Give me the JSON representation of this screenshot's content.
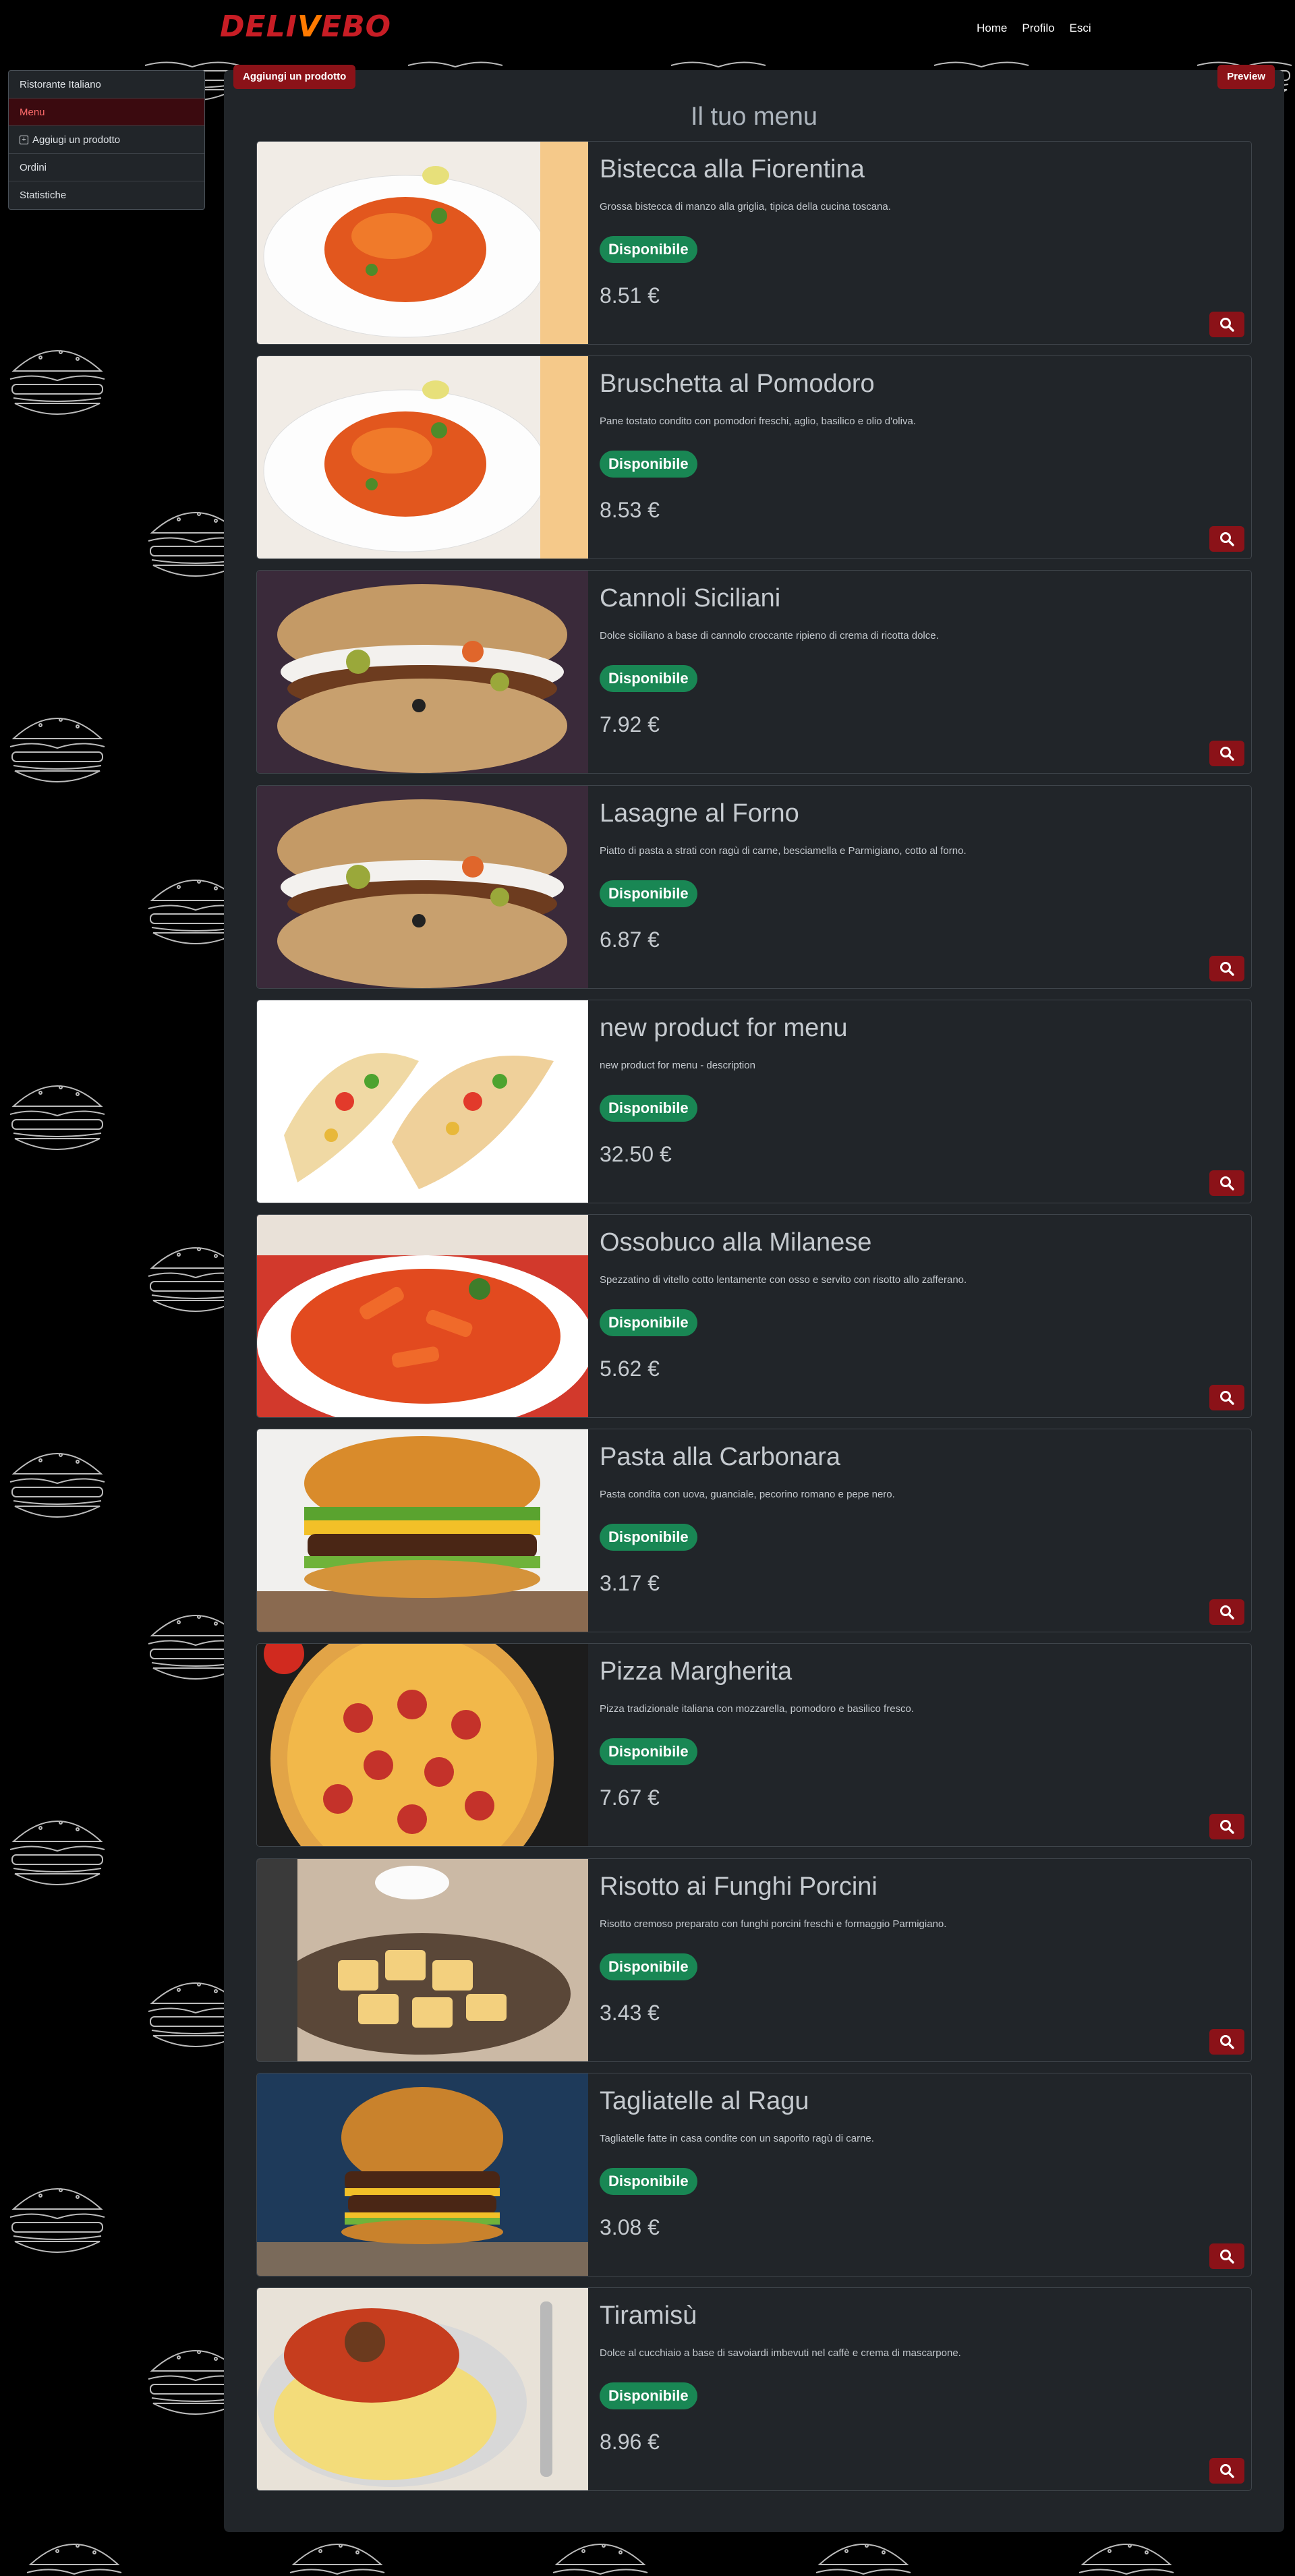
{
  "brand": {
    "logo_text_a": "DELI",
    "logo_text_b": "V",
    "logo_text_c": "EBO"
  },
  "nav": {
    "home": "Home",
    "profile": "Profilo",
    "logout": "Esci"
  },
  "sidebar": {
    "items": [
      {
        "label": "Ristorante Italiano"
      },
      {
        "label": "Menu"
      },
      {
        "label": "Aggiugi un prodotto"
      },
      {
        "label": "Ordini"
      },
      {
        "label": "Statistiche"
      }
    ]
  },
  "toolbar": {
    "add_product": "Aggiungi un prodotto",
    "preview": "Preview"
  },
  "page": {
    "title": "Il tuo menu"
  },
  "products": [
    {
      "name": "Bistecca alla Fiorentina",
      "description": "Grossa bistecca di manzo alla griglia, tipica della cucina toscana.",
      "status": "Disponibile",
      "price": "8.51 €",
      "image": "pasta"
    },
    {
      "name": "Bruschetta al Pomodoro",
      "description": "Pane tostato condito con pomodori freschi, aglio, basilico e olio d'oliva.",
      "status": "Disponibile",
      "price": "8.53 €",
      "image": "pasta"
    },
    {
      "name": "Cannoli Siciliani",
      "description": "Dolce siciliano a base di cannolo croccante ripieno di crema di ricotta dolce.",
      "status": "Disponibile",
      "price": "7.92 €",
      "image": "sandwich"
    },
    {
      "name": "Lasagne al Forno",
      "description": "Piatto di pasta a strati con ragù di carne, besciamella e Parmigiano, cotto al forno.",
      "status": "Disponibile",
      "price": "6.87 €",
      "image": "sandwich"
    },
    {
      "name": "new product for menu",
      "description": "new product for menu - description",
      "status": "Disponibile",
      "price": "32.50 €",
      "image": "tacos"
    },
    {
      "name": "Ossobuco alla Milanese",
      "description": "Spezzatino di vitello cotto lentamente con osso e servito con risotto allo zafferano.",
      "status": "Disponibile",
      "price": "5.62 €",
      "image": "penne"
    },
    {
      "name": "Pasta alla Carbonara",
      "description": "Pasta condita con uova, guanciale, pecorino romano e pepe nero.",
      "status": "Disponibile",
      "price": "3.17 €",
      "image": "burger"
    },
    {
      "name": "Pizza Margherita",
      "description": "Pizza tradizionale italiana con mozzarella, pomodoro e basilico fresco.",
      "status": "Disponibile",
      "price": "7.67 €",
      "image": "pizza"
    },
    {
      "name": "Risotto ai Funghi Porcini",
      "description": "Risotto cremoso preparato con funghi porcini freschi e formaggio Parmigiano.",
      "status": "Disponibile",
      "price": "3.43 €",
      "image": "halloumi"
    },
    {
      "name": "Tagliatelle al Ragu",
      "description": "Tagliatelle fatte in casa condite con un saporito ragù di carne.",
      "status": "Disponibile",
      "price": "3.08 €",
      "image": "burger2"
    },
    {
      "name": "Tiramisù",
      "description": "Dolce al cucchiaio a base di savoiardi imbevuti nel caffè e crema di mascarpone.",
      "status": "Disponibile",
      "price": "8.96 €",
      "image": "stew"
    }
  ],
  "colors": {
    "accent": "#8b1218",
    "success": "#198754",
    "panel": "#212529"
  }
}
